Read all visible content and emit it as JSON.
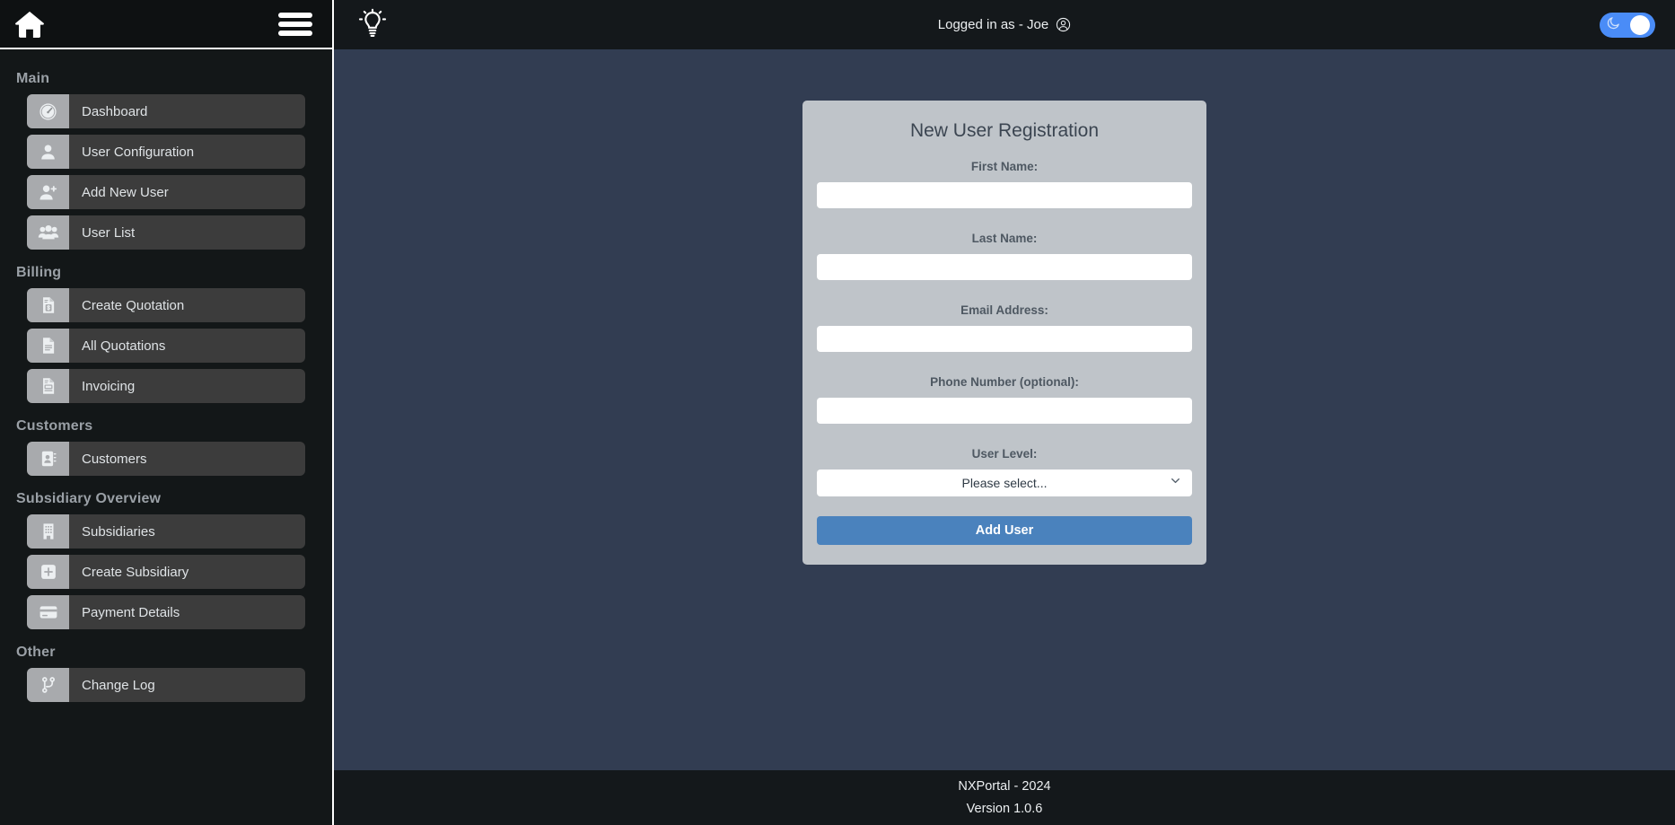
{
  "app": {
    "home_icon": "home-icon",
    "menu_icon": "hamburger-menu-icon"
  },
  "topbar": {
    "theme_hint_icon": "lightbulb-icon",
    "logged_in_text": "Logged in as - Joe",
    "user_icon": "user-circle-icon",
    "dark_mode_toggle": {
      "icon": "moon-icon",
      "state": "on",
      "accent_color": "#4a8cf7"
    }
  },
  "sidebar": {
    "sections": [
      {
        "title": "Main",
        "items": [
          {
            "label": "Dashboard",
            "icon": "gauge-icon"
          },
          {
            "label": "User Configuration",
            "icon": "user-icon"
          },
          {
            "label": "Add New User",
            "icon": "user-plus-icon"
          },
          {
            "label": "User List",
            "icon": "users-group-icon"
          }
        ]
      },
      {
        "title": "Billing",
        "items": [
          {
            "label": "Create Quotation",
            "icon": "document-dollar-icon"
          },
          {
            "label": "All Quotations",
            "icon": "document-lines-icon"
          },
          {
            "label": "Invoicing",
            "icon": "invoice-icon"
          }
        ]
      },
      {
        "title": "Customers",
        "items": [
          {
            "label": "Customers",
            "icon": "contact-book-icon"
          }
        ]
      },
      {
        "title": "Subsidiary Overview",
        "items": [
          {
            "label": "Subsidiaries",
            "icon": "building-icon"
          },
          {
            "label": "Create Subsidiary",
            "icon": "plus-square-icon"
          },
          {
            "label": "Payment Details",
            "icon": "credit-card-icon"
          }
        ]
      },
      {
        "title": "Other",
        "items": [
          {
            "label": "Change Log",
            "icon": "git-branch-icon"
          }
        ]
      }
    ]
  },
  "form": {
    "title": "New User Registration",
    "fields": [
      {
        "label": "First Name:",
        "value": "",
        "placeholder": ""
      },
      {
        "label": "Last Name:",
        "value": "",
        "placeholder": ""
      },
      {
        "label": "Email Address:",
        "value": "",
        "placeholder": ""
      },
      {
        "label": "Phone Number (optional):",
        "value": "",
        "placeholder": ""
      }
    ],
    "select": {
      "label": "User Level:",
      "selected": "Please select...",
      "chevron_icon": "chevron-down-icon"
    },
    "submit_label": "Add User",
    "accent_color": "#4a82bd",
    "card_color": "#bfc4c9"
  },
  "footer": {
    "line1": "NXPortal - 2024",
    "line2": "Version 1.0.6"
  }
}
